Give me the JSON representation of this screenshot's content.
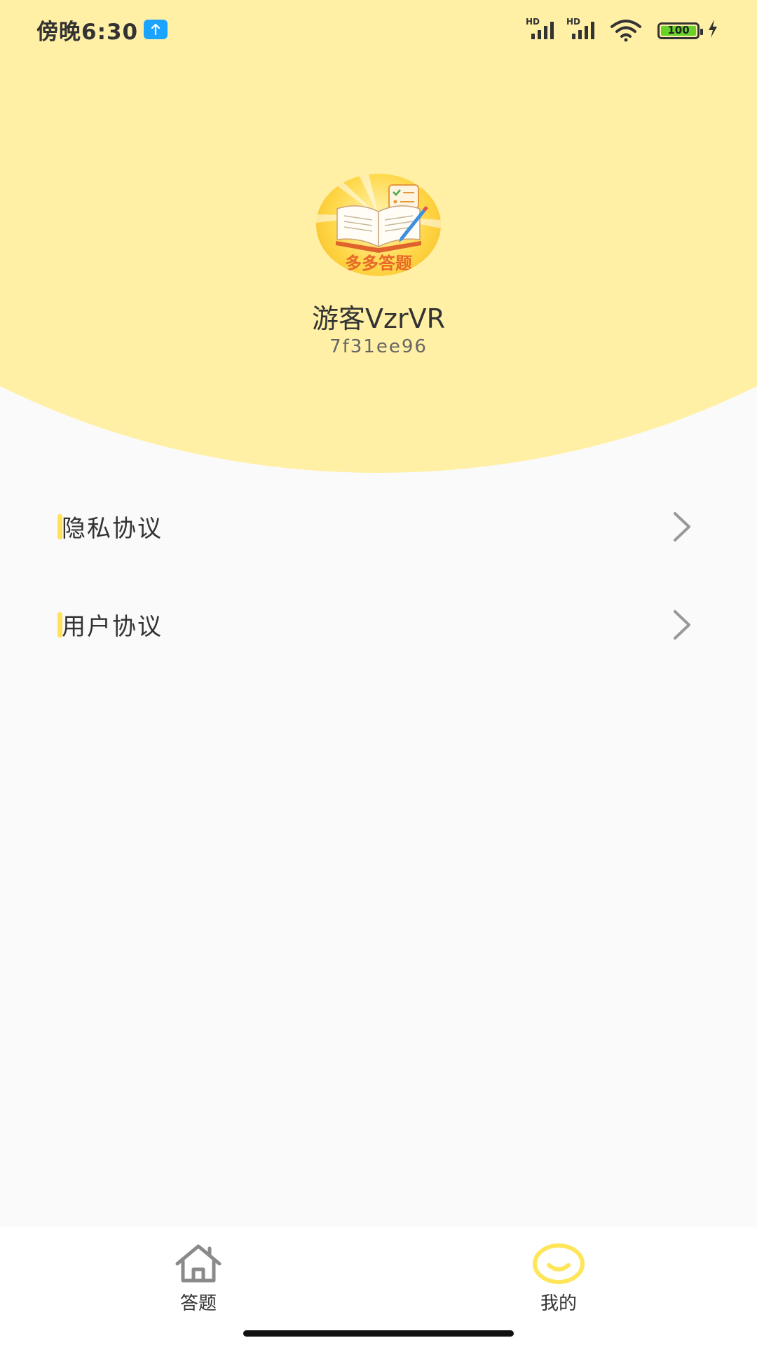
{
  "status_bar": {
    "time": "傍晚6:30",
    "signal_1_label": "HD",
    "signal_2_label": "HD",
    "battery_level": "100",
    "icons": [
      "upload-icon",
      "signal-icon",
      "signal-icon",
      "wifi-icon",
      "battery-icon",
      "charging-icon"
    ]
  },
  "profile": {
    "avatar_text": "多多答题",
    "username": "游客VzrVR",
    "user_id": "7f31ee96"
  },
  "menu": {
    "items": [
      {
        "label": "隐私协议"
      },
      {
        "label": "用户协议"
      }
    ]
  },
  "tabbar": {
    "tabs": [
      {
        "label": "答题",
        "icon": "home-icon",
        "active": false
      },
      {
        "label": "我的",
        "icon": "smile-icon",
        "active": true
      }
    ]
  },
  "colors": {
    "header_yellow": "#fff0a6",
    "accent_yellow": "#ffe15a",
    "background": "#fafafa"
  }
}
